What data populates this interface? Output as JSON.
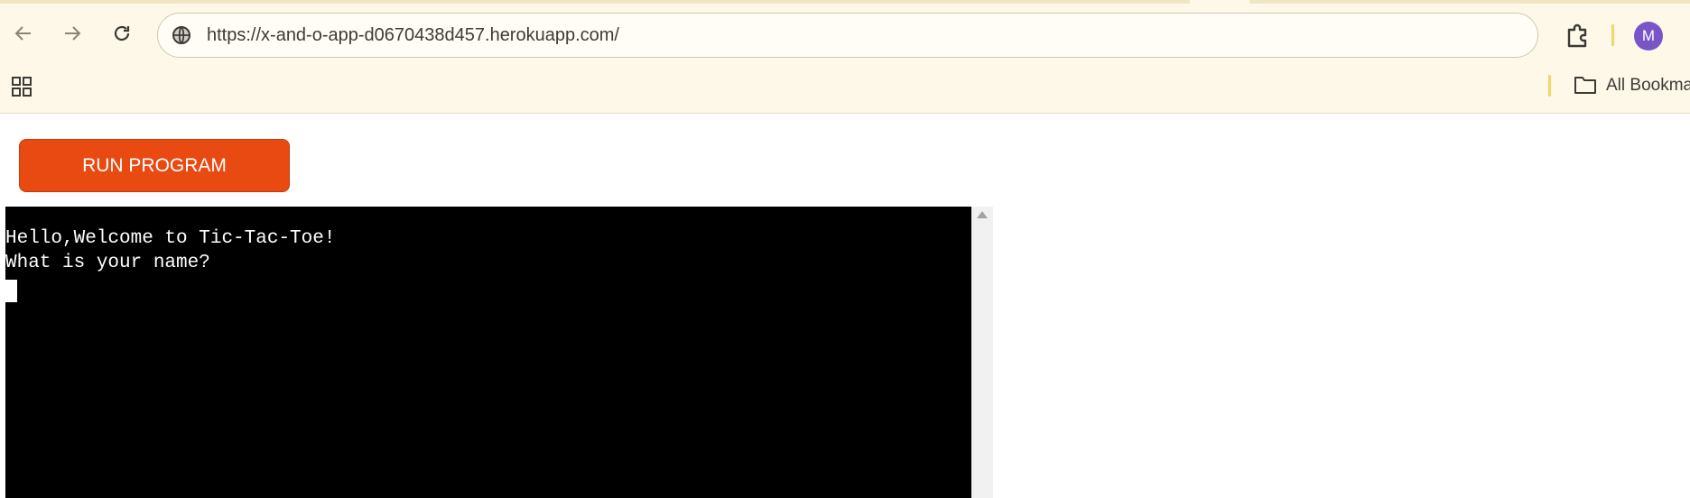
{
  "browser": {
    "url": "https://x-and-o-app-d0670438d457.herokuapp.com/",
    "back_icon": "arrow-left",
    "forward_icon": "arrow-right",
    "reload_icon": "reload",
    "avatar_initial": "M",
    "bookmarks_label": "All Bookmarks",
    "accent": "#7a55c8"
  },
  "page": {
    "run_button_label": "RUN PROGRAM",
    "run_button_color": "#e84a12"
  },
  "terminal": {
    "lines": [
      "Hello,Welcome to Tic-Tac-Toe!",
      "What is your name?"
    ]
  }
}
